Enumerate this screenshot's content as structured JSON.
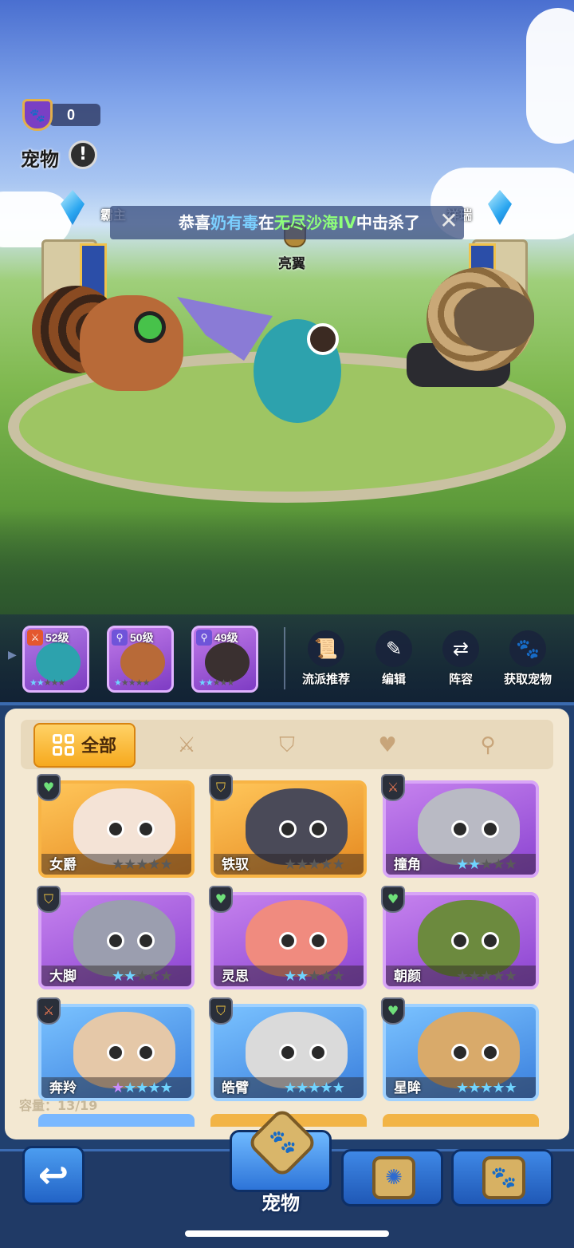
{
  "header": {
    "badge_count": "0",
    "title": "宠物",
    "info_symbol": "!"
  },
  "arena": {
    "left_owner": "霸主",
    "right_owner": "祥瑞",
    "center_pet_name": "亮翼",
    "announcement": {
      "prefix": "恭喜",
      "player": "奶有毒",
      "mid": "在",
      "location": "无尽沙海IV",
      "suffix": "中击杀了",
      "close_symbol": "✕"
    }
  },
  "lineup": [
    {
      "level": "52级",
      "role_icon": "attack-icon",
      "stars_on": 2,
      "stars_total": 5
    },
    {
      "level": "50级",
      "role_icon": "support-icon",
      "stars_on": 1,
      "stars_total": 5
    },
    {
      "level": "49级",
      "role_icon": "support-icon",
      "stars_on": 2,
      "stars_total": 5
    }
  ],
  "actions": [
    {
      "label": "流派推荐",
      "icon": "scroll-icon"
    },
    {
      "label": "编辑",
      "icon": "pencil-icon"
    },
    {
      "label": "阵容",
      "icon": "swap-icon"
    },
    {
      "label": "获取宠物",
      "icon": "paw-icon"
    }
  ],
  "tabs": {
    "all_label": "全部",
    "filters": [
      "attack-filter-icon",
      "defense-filter-icon",
      "heal-filter-icon",
      "support-filter-icon"
    ]
  },
  "pets": [
    {
      "name": "女爵",
      "rarity": "orange",
      "role": "heal",
      "stars": "☆☆☆☆☆",
      "stars_on": 0,
      "color": "#f4e3d6"
    },
    {
      "name": "铁驭",
      "rarity": "orange",
      "role": "defense",
      "stars": "☆☆☆☆☆",
      "stars_on": 0,
      "color": "#4a4a58"
    },
    {
      "name": "撞角",
      "rarity": "purple",
      "role": "attack",
      "stars": "★★☆☆☆",
      "stars_on": 2,
      "color": "#b9bac4"
    },
    {
      "name": "大脚",
      "rarity": "purple",
      "role": "defense",
      "stars": "★★☆☆☆",
      "stars_on": 2,
      "color": "#9b9eaf"
    },
    {
      "name": "灵思",
      "rarity": "purple",
      "role": "heal",
      "stars": "★★☆☆☆",
      "stars_on": 2,
      "color": "#f08b7f"
    },
    {
      "name": "朝颜",
      "rarity": "purple",
      "role": "heal",
      "stars": "☆☆☆☆☆",
      "stars_on": 0,
      "color": "#6c8a3e"
    },
    {
      "name": "奔羚",
      "rarity": "blue",
      "role": "attack",
      "stars": "★★★★★",
      "stars_on": 5,
      "color": "#e5c8a8"
    },
    {
      "name": "皓臂",
      "rarity": "blue",
      "role": "defense",
      "stars": "★★★★★",
      "stars_on": 5,
      "color": "#dadada"
    },
    {
      "name": "星眸",
      "rarity": "blue",
      "role": "heal",
      "stars": "★★★★★",
      "stars_on": 5,
      "color": "#d9aa6a"
    }
  ],
  "capacity": "容量：13/19",
  "bottom_nav": {
    "back_symbol": "↩",
    "active_label": "宠物",
    "tabs": [
      "pet-tab-icon",
      "rune-tab-icon",
      "book-tab-icon"
    ]
  },
  "colors": {
    "orange_card": "#f6a91e",
    "purple_card": "#8b44d1",
    "blue_card": "#3a7fdd",
    "star_blue": "#6fd4ff",
    "panel_bg": "#f3e8d2"
  }
}
